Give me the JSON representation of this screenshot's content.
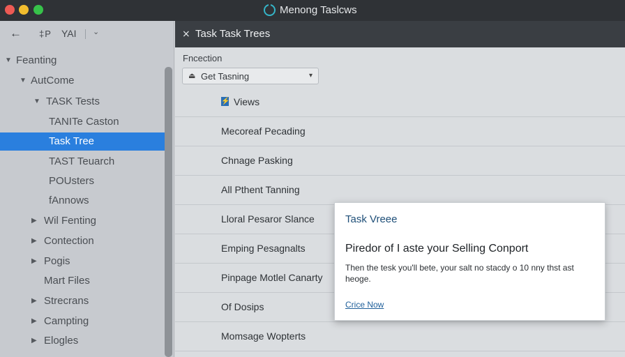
{
  "window": {
    "title": "Menong Taslcws",
    "app_icon": "power-ring-icon",
    "traffic_lights": {
      "close": "#ed5a54",
      "minimize": "#f2bd2e",
      "zoom": "#37c24a"
    }
  },
  "sidebar": {
    "toolbar": {
      "back_icon": "arrow-left-icon",
      "mid_text": "‡P",
      "label": "YAI",
      "dropdown_icon": "chevron-down-icon"
    },
    "items": [
      {
        "label": "Feanting",
        "chevron": "▼"
      },
      {
        "label": "AutCome",
        "chevron": "▼"
      },
      {
        "label": "TASK Tests",
        "chevron": "▼"
      },
      {
        "label": "TANITe Caston",
        "chevron": ""
      },
      {
        "label": "Task Tree",
        "chevron": "",
        "selected": true
      },
      {
        "label": "TAST Teuarch",
        "chevron": ""
      },
      {
        "label": "POUsters",
        "chevron": ""
      },
      {
        "label": "fAnnows",
        "chevron": ""
      },
      {
        "label": "Wil Fenting",
        "chevron": "▶"
      },
      {
        "label": "Contection",
        "chevron": "▶"
      },
      {
        "label": "Pogis",
        "chevron": "▶"
      },
      {
        "label": "Mart Files",
        "chevron": ""
      },
      {
        "label": "Strecrans",
        "chevron": "▶"
      },
      {
        "label": "Campting",
        "chevron": "▶"
      },
      {
        "label": "Elogles",
        "chevron": "▶"
      }
    ],
    "selected_color": "#2a7fde"
  },
  "main": {
    "header": {
      "icon": "wrench-icon",
      "title": "Task Task Trees"
    },
    "section_label": "Fncection",
    "combo": {
      "icon": "eject-icon",
      "value": "Get Tasning",
      "chevron": "▾"
    },
    "list": [
      {
        "label": "Views",
        "icon": "views-icon"
      },
      {
        "label": "Mecoreaf Pecading"
      },
      {
        "label": "Chnage Pasking"
      },
      {
        "label": "All Pthent Tanning"
      },
      {
        "label": "Lloral Pesaror Slance"
      },
      {
        "label": "Emping Pesagnalts"
      },
      {
        "label": "Pinpage Motlel Canarty"
      },
      {
        "label": "Of Dosips"
      },
      {
        "label": "Momsage Wopterts"
      }
    ]
  },
  "popup": {
    "title": "Task Vreee",
    "heading": "Piredor of I aste your Selling Conport",
    "body": "Then the tesk you'll bete, your salt no stacdy o 10 nny thst ast heoge.",
    "link": "Crice Now"
  }
}
